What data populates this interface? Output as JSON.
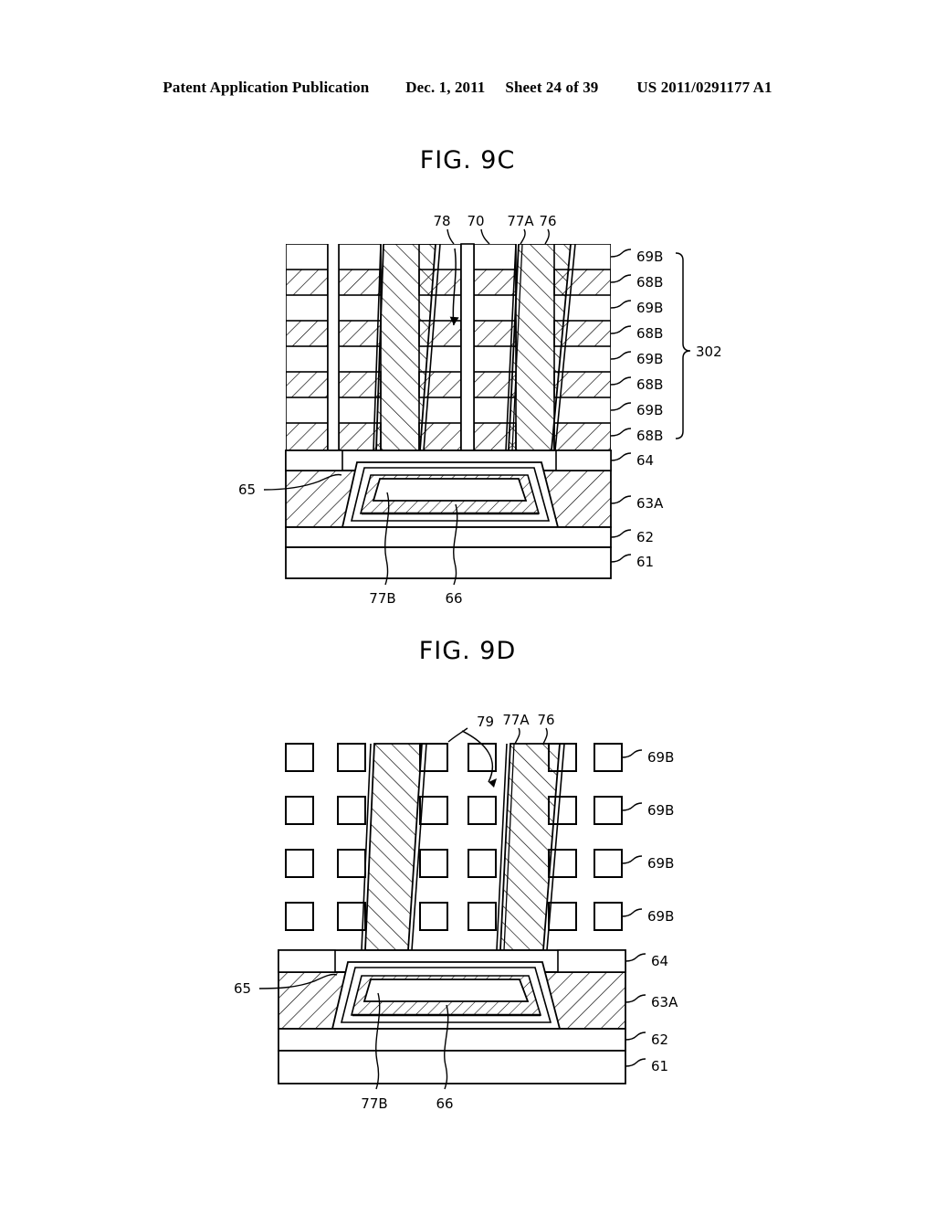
{
  "header": {
    "publication": "Patent Application Publication",
    "date": "Dec. 1, 2011",
    "sheet": "Sheet 24 of 39",
    "patent_number": "US 2011/0291177 A1"
  },
  "figures": [
    {
      "id": "fig9c",
      "title": "FIG. 9C",
      "top_labels": [
        "78",
        "70",
        "77A",
        "76"
      ],
      "right_labels": [
        "69B",
        "68B",
        "69B",
        "68B",
        "69B",
        "68B",
        "69B",
        "68B"
      ],
      "bracket_label": "302",
      "right_lower_labels": [
        "64",
        "63A",
        "62",
        "61"
      ],
      "left_label": "65",
      "bottom_labels": [
        "77B",
        "66"
      ]
    },
    {
      "id": "fig9d",
      "title": "FIG. 9D",
      "top_labels": [
        "79",
        "77A",
        "76"
      ],
      "right_labels": [
        "69B",
        "69B",
        "69B",
        "69B"
      ],
      "right_lower_labels": [
        "64",
        "63A",
        "62",
        "61"
      ],
      "left_label": "65",
      "bottom_labels": [
        "77B",
        "66"
      ]
    }
  ],
  "style": {
    "line_color": "#000000",
    "fill_color": "#ffffff",
    "hatch_color": "#000000"
  }
}
